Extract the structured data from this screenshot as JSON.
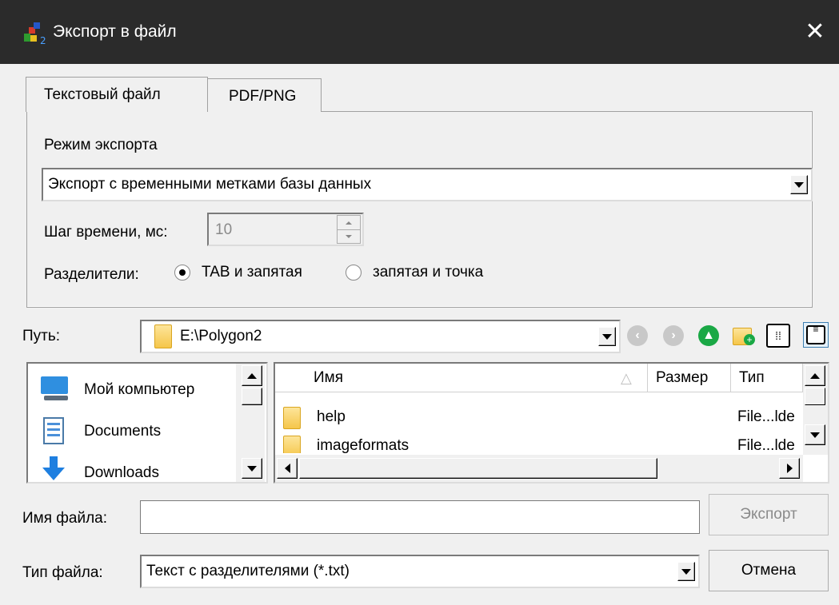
{
  "window": {
    "title": "Экспорт в файл"
  },
  "tabs": [
    {
      "label": "Текстовый файл"
    },
    {
      "label": "PDF/PNG"
    }
  ],
  "export_mode": {
    "label": "Режим экспорта",
    "selected": "Экспорт с временными метками базы данных"
  },
  "time_step": {
    "label": "Шаг времени, мс:",
    "value": "10"
  },
  "separators": {
    "label": "Разделители:",
    "options": [
      {
        "label": "TAB и запятая",
        "checked": true
      },
      {
        "label": "запятая и точка",
        "checked": false
      }
    ]
  },
  "path": {
    "label": "Путь:",
    "value": "E:\\Polygon2"
  },
  "places": [
    {
      "label": "Мой компьютер",
      "icon": "computer-icon"
    },
    {
      "label": "Documents",
      "icon": "documents-icon"
    },
    {
      "label": "Downloads",
      "icon": "download-arrow-icon"
    }
  ],
  "files": {
    "columns": [
      "Имя",
      "Размер",
      "Тип"
    ],
    "rows": [
      {
        "name": "help",
        "size": "",
        "type": "File...lde"
      },
      {
        "name": "imageformats",
        "size": "",
        "type": "File...lde"
      }
    ]
  },
  "filename": {
    "label": "Имя файла:",
    "value": ""
  },
  "filetype": {
    "label": "Тип файла:",
    "selected": "Текст с разделителями (*.txt)"
  },
  "buttons": {
    "export": "Экспорт",
    "cancel": "Отмена"
  }
}
